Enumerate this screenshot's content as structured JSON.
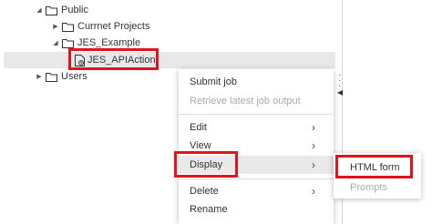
{
  "tree": {
    "public": "Public",
    "current_projects": "Currnet Projects",
    "jes_example": "JES_Example",
    "jes_apiaction": "JES_APIAction",
    "users": "Users"
  },
  "context_menu": {
    "submit_job": "Submit job",
    "retrieve_output": "Retrieve latest job output",
    "edit": "Edit",
    "view": "View",
    "display": "Display",
    "delete": "Delete",
    "rename": "Rename",
    "submenu_arrow": "›"
  },
  "display_submenu": {
    "html_form": "HTML form",
    "prompts": "Prompts"
  },
  "colors": {
    "highlight_box": "#e0141e",
    "selected_row": "#e8e8e8",
    "disabled_text": "#aaaaaa"
  }
}
